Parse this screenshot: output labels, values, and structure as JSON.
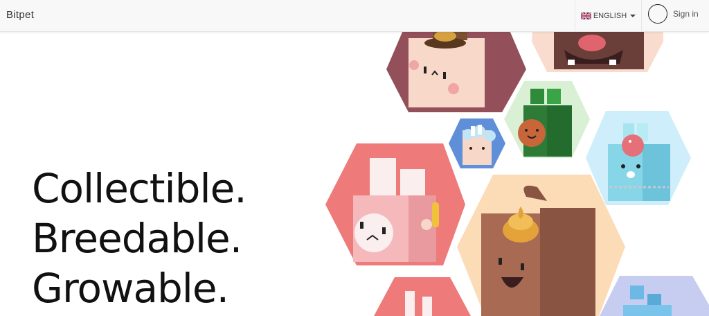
{
  "navbar": {
    "brand": "Bitpet",
    "language": {
      "label": "ENGLISH",
      "flag": "uk-flag-icon"
    },
    "signin": {
      "label": "Sign in",
      "icon": "avatar-circle-icon"
    }
  },
  "hero": {
    "lines": [
      "Collectible.",
      "Breedable.",
      "Growable."
    ]
  },
  "pets": [
    {
      "name": "pet-bunny-hat-icon"
    },
    {
      "name": "pet-brown-tongue-icon"
    },
    {
      "name": "pet-green-bunny-icon"
    },
    {
      "name": "pet-blue-cloud-icon"
    },
    {
      "name": "pet-cyan-bunny-icon"
    },
    {
      "name": "pet-pink-bunny-icon"
    },
    {
      "name": "pet-brown-pudding-icon"
    },
    {
      "name": "pet-pink-bottom-icon"
    },
    {
      "name": "pet-blue-bottom-icon"
    }
  ],
  "colors": {
    "navbar_bg": "#f8f8f8",
    "hex_pink": "#ee7a7a",
    "hex_peach": "#fcdcb6",
    "hex_mint": "#d9f0d4",
    "hex_sky": "#cdeefa",
    "hex_lavender": "#c6cdf0"
  }
}
